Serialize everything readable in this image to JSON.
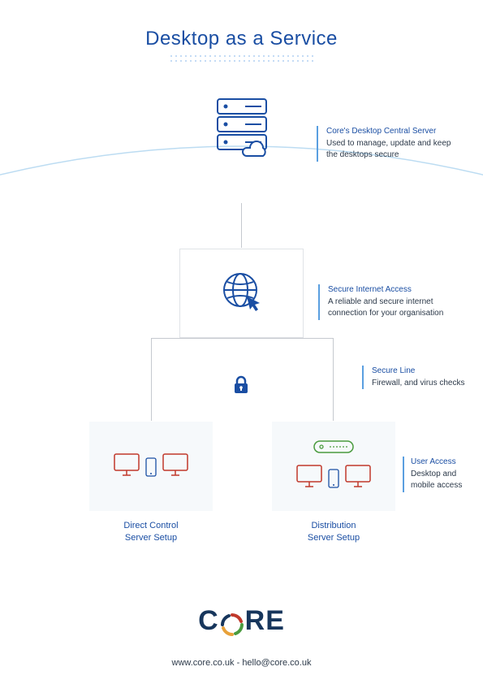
{
  "title": "Desktop as a Service",
  "server": {
    "desc_title": "Core's Desktop Central Server",
    "desc_body": "Used to manage, update and keep the desktops secure"
  },
  "net": {
    "desc_title": "Secure Internet Access",
    "desc_body": "A reliable and secure internet connection for your organisation"
  },
  "secure": {
    "desc_title": "Secure Line",
    "desc_body": "Firewall, and virus checks"
  },
  "card_a": {
    "label_1": "Direct Control",
    "label_2": "Server Setup"
  },
  "card_b": {
    "label_1": "Distribution",
    "label_2": "Server Setup"
  },
  "user": {
    "desc_title": "User Access",
    "desc_body": "Desktop and mobile access"
  },
  "logo_text_left": "C",
  "logo_text_right": "RE",
  "contact": "www.core.co.uk - hello@core.co.uk"
}
